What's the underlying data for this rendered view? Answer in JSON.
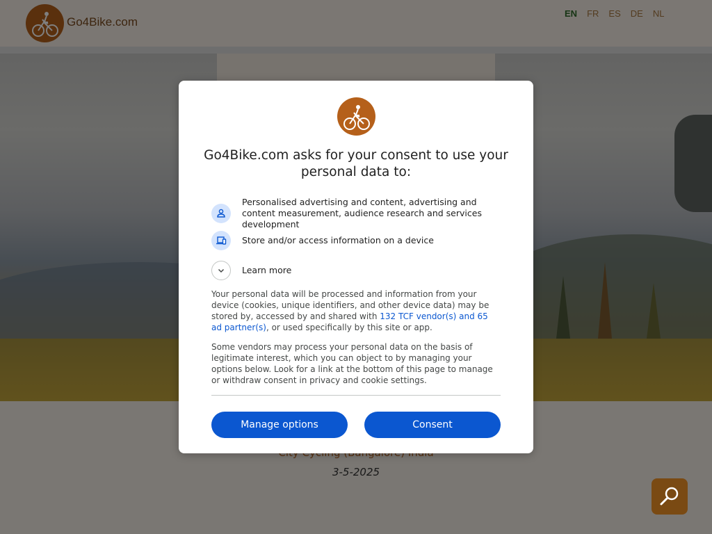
{
  "site": {
    "name": "Go4Bike.com",
    "languages": [
      {
        "code": "EN",
        "active": true
      },
      {
        "code": "FR",
        "active": false
      },
      {
        "code": "ES",
        "active": false
      },
      {
        "code": "DE",
        "active": false
      },
      {
        "code": "NL",
        "active": false
      }
    ],
    "route_text": "City Cycling (Bangalore) India",
    "date_text": "3-5-2025"
  },
  "consent_dialog": {
    "title": "Go4Bike.com asks for your consent to use your personal data to:",
    "purposes": [
      {
        "icon": "person-icon",
        "text": "Personalised advertising and content, advertising and content measurement, audience research and services development"
      },
      {
        "icon": "devices-icon",
        "text": "Store and/or access information on a device"
      },
      {
        "icon": "chevron-down-icon",
        "text": "Learn more"
      }
    ],
    "paragraph1_before": "Your personal data will be processed and information from your device (cookies, unique identifiers, and other device data) may be stored by, accessed by and shared with ",
    "vendor_link": "132 TCF vendor(s) and 65 ad partner(s)",
    "paragraph1_after": ", or used specifically by this site or app.",
    "paragraph2": "Some vendors may process your personal data on the basis of legitimate interest, which you can object to by managing your options below. Look for a link at the bottom of this page to manage or withdraw consent in privacy and cookie settings.",
    "manage_label": "Manage options",
    "consent_label": "Consent"
  },
  "colors": {
    "brand": "#b5601a",
    "button": "#0b57d0",
    "link": "#0b57d0"
  }
}
